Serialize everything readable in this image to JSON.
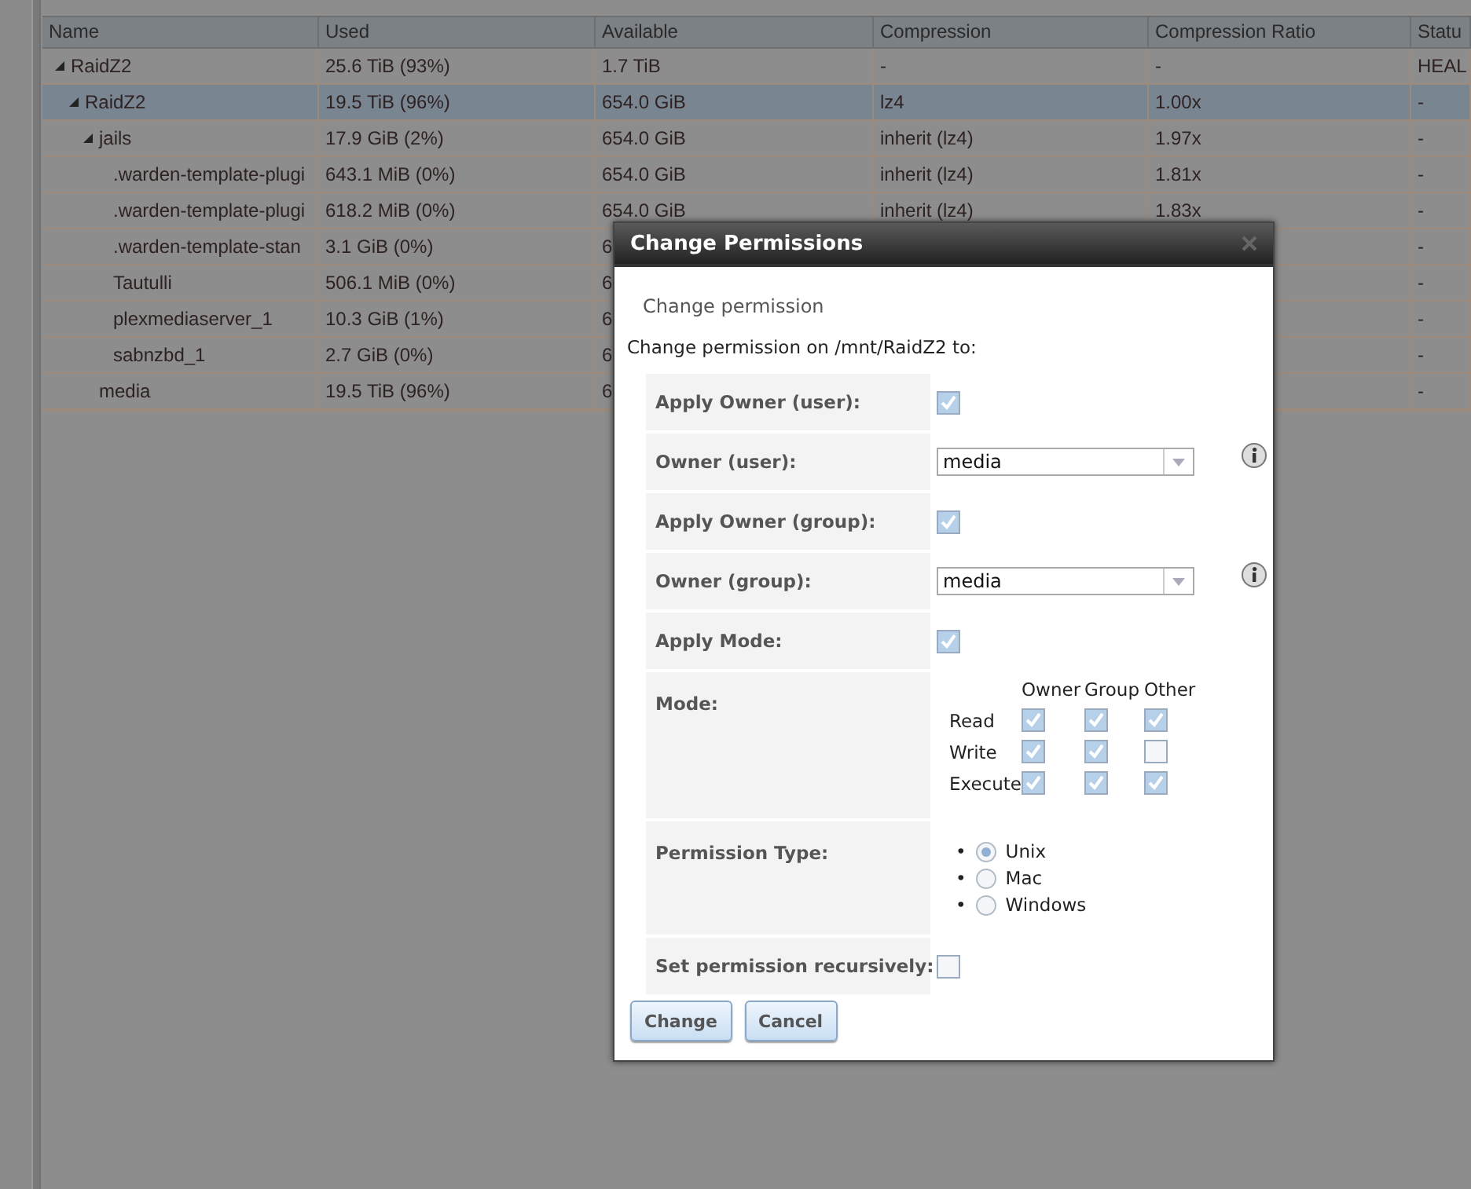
{
  "table": {
    "columns": [
      "Name",
      "Used",
      "Available",
      "Compression",
      "Compression Ratio",
      "Statu"
    ],
    "rows": [
      {
        "name": "RaidZ2",
        "used": "25.6 TiB (93%)",
        "available": "1.7 TiB",
        "compression": "-",
        "ratio": "-",
        "status": "HEAL",
        "expanded": true,
        "selected": false,
        "children": [
          {
            "name": "RaidZ2",
            "used": "19.5 TiB (96%)",
            "available": "654.0 GiB",
            "compression": "lz4",
            "ratio": "1.00x",
            "status": "-",
            "expanded": true,
            "selected": true,
            "children": [
              {
                "name": "jails",
                "used": "17.9 GiB (2%)",
                "available": "654.0 GiB",
                "compression": "inherit (lz4)",
                "ratio": "1.97x",
                "status": "-",
                "expanded": true,
                "selected": false,
                "children": [
                  {
                    "name": ".warden-template-plugi",
                    "used": "643.1 MiB (0%)",
                    "available": "654.0 GiB",
                    "compression": "inherit (lz4)",
                    "ratio": "1.81x",
                    "status": "-",
                    "selected": false
                  },
                  {
                    "name": ".warden-template-plugi",
                    "used": "618.2 MiB (0%)",
                    "available": "654.0 GiB",
                    "compression": "inherit (lz4)",
                    "ratio": "1.83x",
                    "status": "-",
                    "selected": false
                  },
                  {
                    "name": ".warden-template-stan",
                    "used": "3.1 GiB (0%)",
                    "available": "6",
                    "status": "-",
                    "selected": false
                  },
                  {
                    "name": "Tautulli",
                    "used": "506.1 MiB (0%)",
                    "available": "6",
                    "status": "-",
                    "selected": false
                  },
                  {
                    "name": "plexmediaserver_1",
                    "used": "10.3 GiB (1%)",
                    "available": "6",
                    "status": "-",
                    "selected": false
                  },
                  {
                    "name": "sabnzbd_1",
                    "used": "2.7 GiB (0%)",
                    "available": "6",
                    "status": "-",
                    "selected": false
                  }
                ]
              },
              {
                "name": "media",
                "used": "19.5 TiB (96%)",
                "available": "6",
                "status": "-",
                "selected": false
              }
            ]
          }
        ]
      }
    ]
  },
  "dialog": {
    "title": "Change Permissions",
    "subtitle": "Change permission",
    "intro": "Change permission on /mnt/RaidZ2 to:",
    "fields": [
      {
        "kind": "checkbox",
        "label": "Apply Owner (user):",
        "checked": true
      },
      {
        "kind": "select",
        "label": "Owner (user):",
        "value": "media"
      },
      {
        "kind": "checkbox",
        "label": "Apply Owner (group):",
        "checked": true
      },
      {
        "kind": "select",
        "label": "Owner (group):",
        "value": "media"
      },
      {
        "kind": "checkbox",
        "label": "Apply Mode:",
        "checked": true
      },
      {
        "kind": "mode",
        "label": "Mode:",
        "columns": [
          "Owner",
          "Group",
          "Other"
        ],
        "rows": [
          {
            "label": "Read",
            "checks": [
              {
                "checked": true
              },
              {
                "checked": true
              },
              {
                "checked": true
              }
            ]
          },
          {
            "label": "Write",
            "checks": [
              {
                "checked": true
              },
              {
                "checked": true
              },
              {
                "checked": false
              }
            ]
          },
          {
            "label": "Execute",
            "checks": [
              {
                "checked": true
              },
              {
                "checked": true
              },
              {
                "checked": true
              }
            ]
          }
        ]
      },
      {
        "kind": "radio",
        "label": "Permission Type:",
        "options": [
          {
            "marker": "•",
            "label": "Unix",
            "selected": true
          },
          {
            "marker": "•",
            "label": "Mac",
            "selected": false
          },
          {
            "marker": "•",
            "label": "Windows",
            "selected": false
          }
        ]
      },
      {
        "kind": "checkbox",
        "label": "Set permission recursively:",
        "checked": false
      }
    ],
    "buttons": [
      "Change",
      "Cancel"
    ]
  }
}
